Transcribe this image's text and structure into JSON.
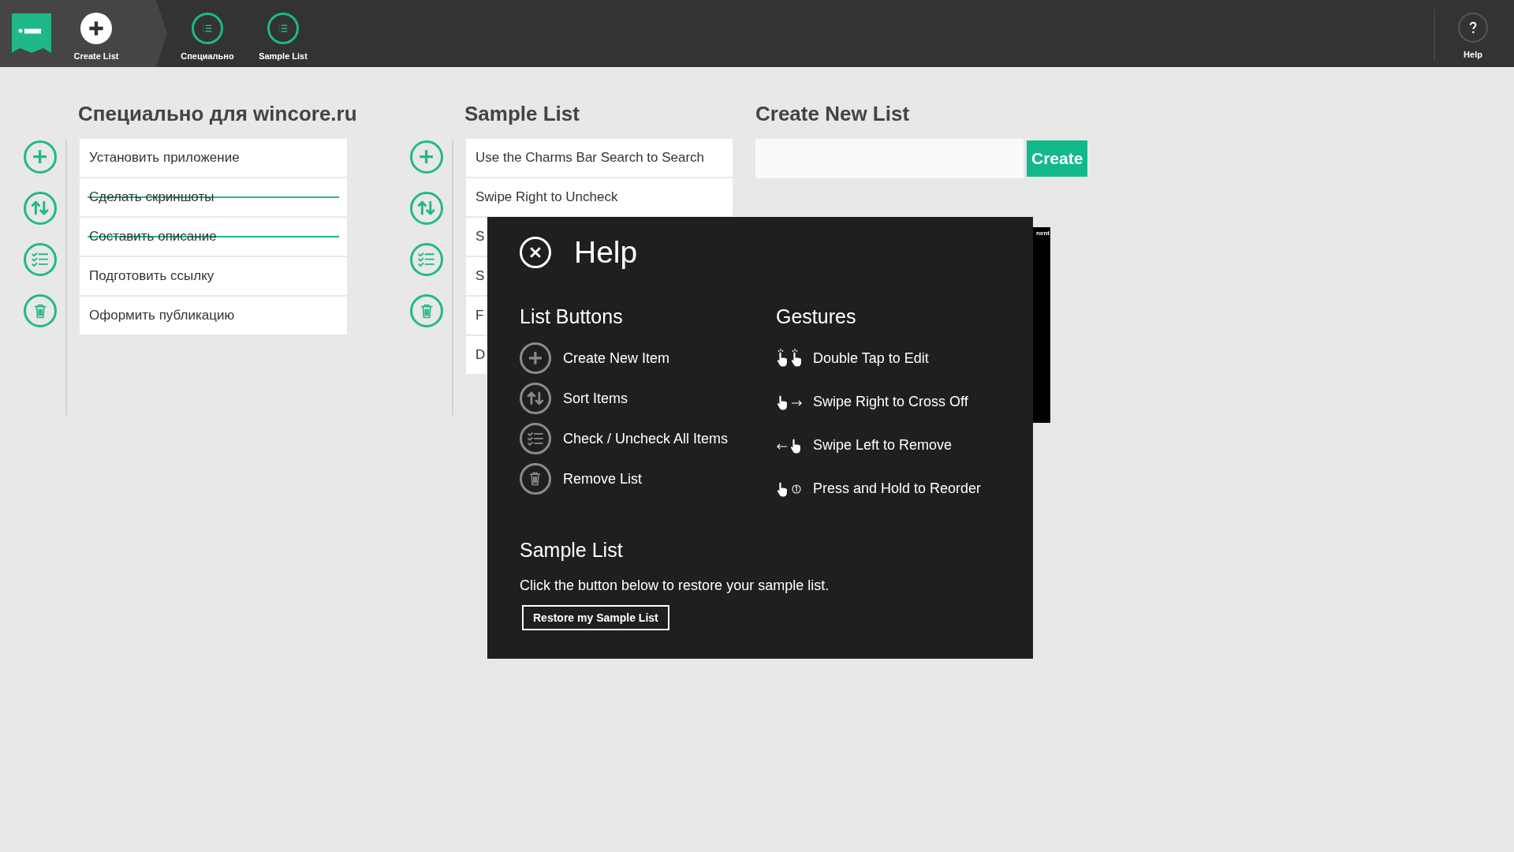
{
  "toolbar": {
    "items": [
      {
        "kind": "create",
        "label": "Create List"
      },
      {
        "kind": "list",
        "label": "Специально"
      },
      {
        "kind": "list",
        "label": "Sample List"
      }
    ],
    "help": "Help"
  },
  "lists": [
    {
      "title": "Специально для wincore.ru",
      "items": [
        {
          "text": "Установить приложение",
          "checked": false
        },
        {
          "text": "Сделать скриншоты",
          "checked": true
        },
        {
          "text": "Составить описание",
          "checked": true
        },
        {
          "text": "Подготовить ссылку",
          "checked": false
        },
        {
          "text": "Оформить публикацию",
          "checked": false
        }
      ]
    },
    {
      "title": "Sample List",
      "items": [
        {
          "text": "Use the Charms Bar Search to Search",
          "checked": false
        },
        {
          "text": "Swipe Right to Uncheck",
          "checked": false
        },
        {
          "text": "S",
          "checked": false
        },
        {
          "text": "S",
          "checked": false
        },
        {
          "text": "F",
          "checked": false
        },
        {
          "text": "D",
          "checked": false
        }
      ]
    }
  ],
  "create_new_list": {
    "title": "Create New List",
    "button": "Create"
  },
  "background_panel": {
    "text": "nent"
  },
  "help_dialog": {
    "title": "Help",
    "list_buttons": {
      "heading": "List Buttons",
      "items": [
        {
          "kind": "add",
          "label": "Create New Item"
        },
        {
          "kind": "sort",
          "label": "Sort Items"
        },
        {
          "kind": "check_all",
          "label": "Check / Uncheck All Items"
        },
        {
          "kind": "remove",
          "label": "Remove List"
        }
      ]
    },
    "gestures": {
      "heading": "Gestures",
      "items": [
        {
          "kind": "double_tap",
          "label": "Double Tap to Edit"
        },
        {
          "kind": "swipe_right",
          "label": "Swipe Right to Cross Off"
        },
        {
          "kind": "swipe_left",
          "label": "Swipe Left to Remove"
        },
        {
          "kind": "hold",
          "label": "Press and Hold to Reorder"
        }
      ]
    },
    "sample_list": {
      "heading": "Sample List",
      "text": "Click the button below to restore your sample list.",
      "button": "Restore my Sample List"
    }
  }
}
